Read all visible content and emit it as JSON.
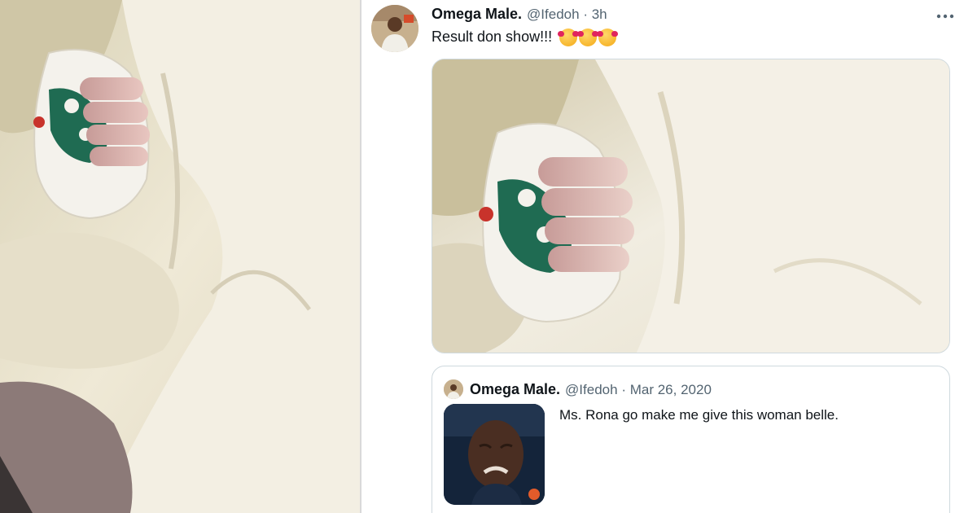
{
  "tweet": {
    "display_name": "Omega Male.",
    "handle": "@Ifedoh",
    "separator": "·",
    "time": "3h",
    "text": "Result don show!!!",
    "emoji_count": 3,
    "more_label": "•••"
  },
  "quoted": {
    "display_name": "Omega Male.",
    "handle": "@Ifedoh",
    "separator": "·",
    "date": "Mar 26, 2020",
    "text": "Ms. Rona go make me give this woman belle."
  },
  "icons": {
    "emoji": "smiling-face-with-hearts-icon",
    "more": "more-options-icon"
  },
  "colors": {
    "text_primary": "#0f1419",
    "text_secondary": "#536471",
    "border": "#cfd9de",
    "blanket": "#e9e3cf",
    "glove_green": "#1f6b52"
  }
}
